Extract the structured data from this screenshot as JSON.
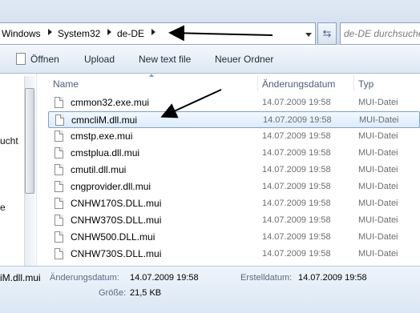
{
  "address": {
    "crumbs": [
      "Windows",
      "System32",
      "de-DE"
    ],
    "search_placeholder": "de-DE durchsuchen"
  },
  "toolbar": {
    "open_label": "Öffnen",
    "upload_label": "Upload",
    "new_text_file_label": "New text file",
    "new_folder_label": "Neuer Ordner"
  },
  "navpane": {
    "partial_items": [
      "ucht",
      "e"
    ]
  },
  "columns": {
    "name": "Name",
    "date": "Änderungsdatum",
    "type": "Typ"
  },
  "files": [
    {
      "name": "cmmon32.exe.mui",
      "date": "14.07.2009 19:58",
      "type": "MUI-Datei"
    },
    {
      "name": "cmncliM.dll.mui",
      "date": "14.07.2009 19:58",
      "type": "MUI-Datei",
      "selected": true
    },
    {
      "name": "cmstp.exe.mui",
      "date": "14.07.2009 19:58",
      "type": "MUI-Datei"
    },
    {
      "name": "cmstplua.dll.mui",
      "date": "14.07.2009 19:58",
      "type": "MUI-Datei"
    },
    {
      "name": "cmutil.dll.mui",
      "date": "14.07.2009 19:58",
      "type": "MUI-Datei"
    },
    {
      "name": "cngprovider.dll.mui",
      "date": "14.07.2009 19:58",
      "type": "MUI-Datei"
    },
    {
      "name": "CNHW170S.DLL.mui",
      "date": "14.07.2009 19:58",
      "type": "MUI-Datei"
    },
    {
      "name": "CNHW370S.DLL.mui",
      "date": "14.07.2009 19:58",
      "type": "MUI-Datei"
    },
    {
      "name": "CNHW500.DLL.mui",
      "date": "14.07.2009 19:58",
      "type": "MUI-Datei"
    },
    {
      "name": "CNHW730S.DLL.mui",
      "date": "14.07.2009 19:58",
      "type": "MUI-Datei"
    }
  ],
  "details": {
    "name": "iM.dll.mui",
    "modified_label": "Änderungsdatum:",
    "modified_value": "14.07.2009 19:58",
    "size_label": "Größe:",
    "size_value": "21,5 KB",
    "created_label": "Erstelldatum:",
    "created_value": "14.07.2009 19:58"
  }
}
